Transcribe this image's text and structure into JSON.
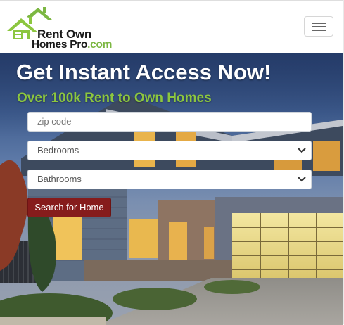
{
  "logo": {
    "line1": "Rent Own",
    "line2_main": "Homes Pro",
    "line2_suffix": ".com",
    "icon": "house-logo-icon"
  },
  "header": {
    "menu_toggle_icon": "hamburger-menu-icon"
  },
  "hero": {
    "headline": "Get Instant Access Now!",
    "subheadline": "Over 100k Rent to Own Homes"
  },
  "search_form": {
    "zip_placeholder": "zip code",
    "bedrooms_selected": "Bedrooms",
    "bathrooms_selected": "Bathrooms",
    "search_button_label": "Search for Home",
    "dropdown_icon": "chevron-down-icon"
  },
  "colors": {
    "brand_green": "#8cc63f",
    "button_red": "#861c1c",
    "headline_white": "#ffffff"
  }
}
